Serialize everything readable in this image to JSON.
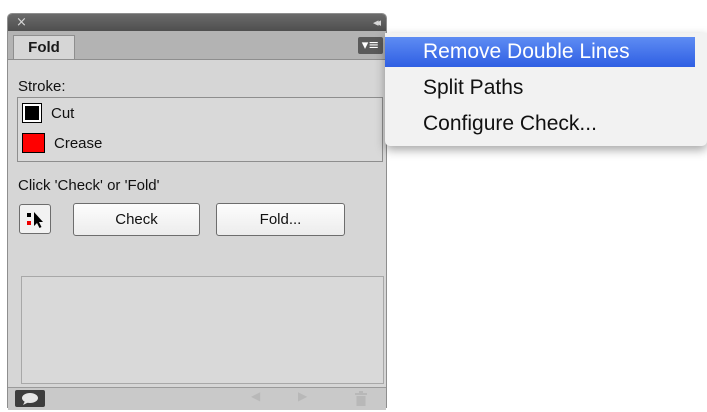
{
  "panel": {
    "tab_label": "Fold",
    "close_glyph": "×",
    "collapse_glyph": "◂◂",
    "menu_glyph": "▾≡",
    "stroke_label": "Stroke:",
    "strokes": [
      {
        "name": "Cut",
        "color": "#000000"
      },
      {
        "name": "Crease",
        "color": "#ff0000"
      }
    ],
    "hint": "Click 'Check' or 'Fold'",
    "check_label": "Check",
    "fold_label": "Fold...",
    "icons": {
      "picker": "picker-icon",
      "balloon": "speech-balloon-icon",
      "prev": "previous-arrow-icon",
      "next": "next-arrow-icon",
      "trash": "trash-icon"
    }
  },
  "menu": {
    "items": [
      {
        "label": "Remove Double Lines",
        "selected": true
      },
      {
        "label": "Split Paths",
        "selected": false
      },
      {
        "label": "Configure Check...",
        "selected": false
      }
    ],
    "highlight_color": "#3d6ef0"
  }
}
